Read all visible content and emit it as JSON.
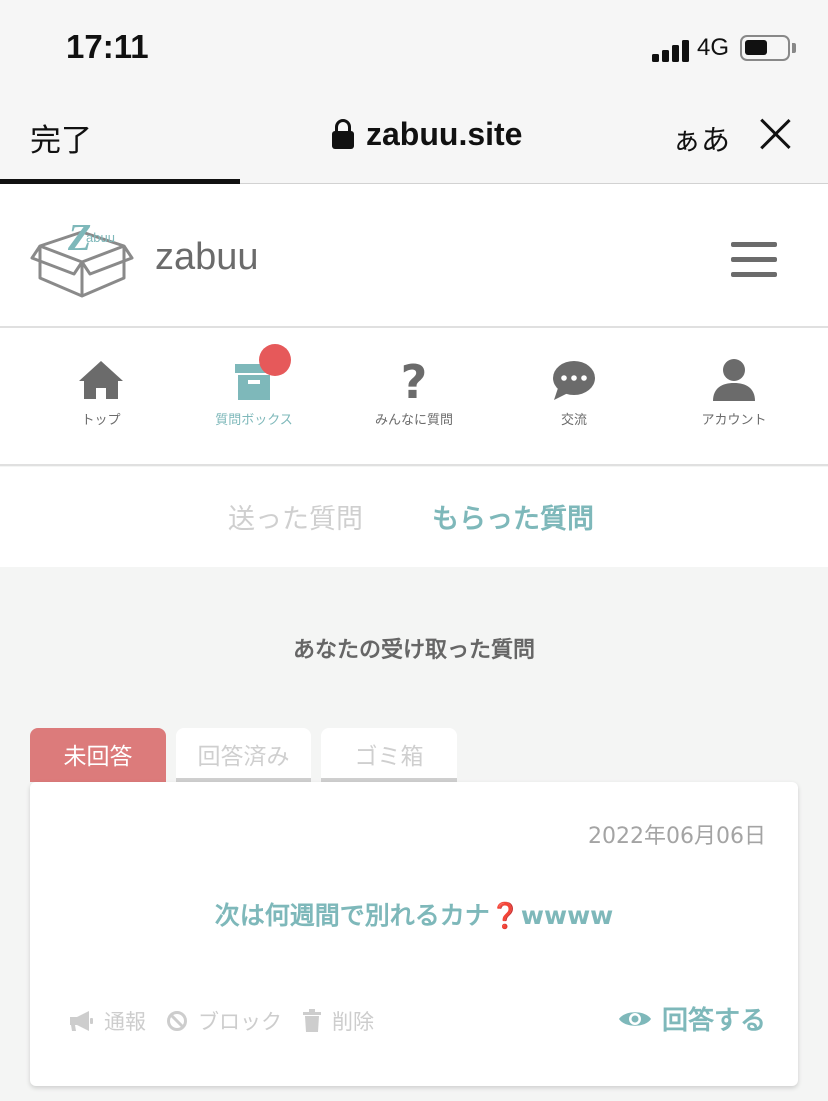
{
  "status_bar": {
    "time": "17:11",
    "network": "4G"
  },
  "browser": {
    "done_label": "完了",
    "url": "zabuu.site",
    "text_size_label": "ぁあ",
    "load_progress": 0.29
  },
  "site": {
    "logo_mark_text": "Zabuu",
    "name": "zabuu"
  },
  "nav": {
    "items": [
      {
        "label": "トップ",
        "icon": "home-icon"
      },
      {
        "label": "質問ボックス",
        "icon": "box-icon",
        "active": true,
        "has_notification": true
      },
      {
        "label": "みんなに質問",
        "icon": "question-icon"
      },
      {
        "label": "交流",
        "icon": "chat-icon"
      },
      {
        "label": "アカウント",
        "icon": "account-icon"
      }
    ]
  },
  "sub_tabs": {
    "sent": "送った質問",
    "received": "もらった質問"
  },
  "section_title": "あなたの受け取った質問",
  "state_tabs": {
    "unanswered": "未回答",
    "answered": "回答済み",
    "trash": "ゴミ箱"
  },
  "card": {
    "date": "2022年06月06日",
    "question_before": "次は何週間で別れるカナ",
    "question_mark": "❓",
    "question_after": "wwww",
    "actions": {
      "report": "通報",
      "block": "ブロック",
      "delete": "削除"
    },
    "answer_label": "回答する"
  },
  "colors": {
    "accent": "#7eb8ba",
    "unanswered_tab": "#dc7b7b",
    "notification": "#e6595a",
    "icon_gray": "#6b6b6b"
  }
}
